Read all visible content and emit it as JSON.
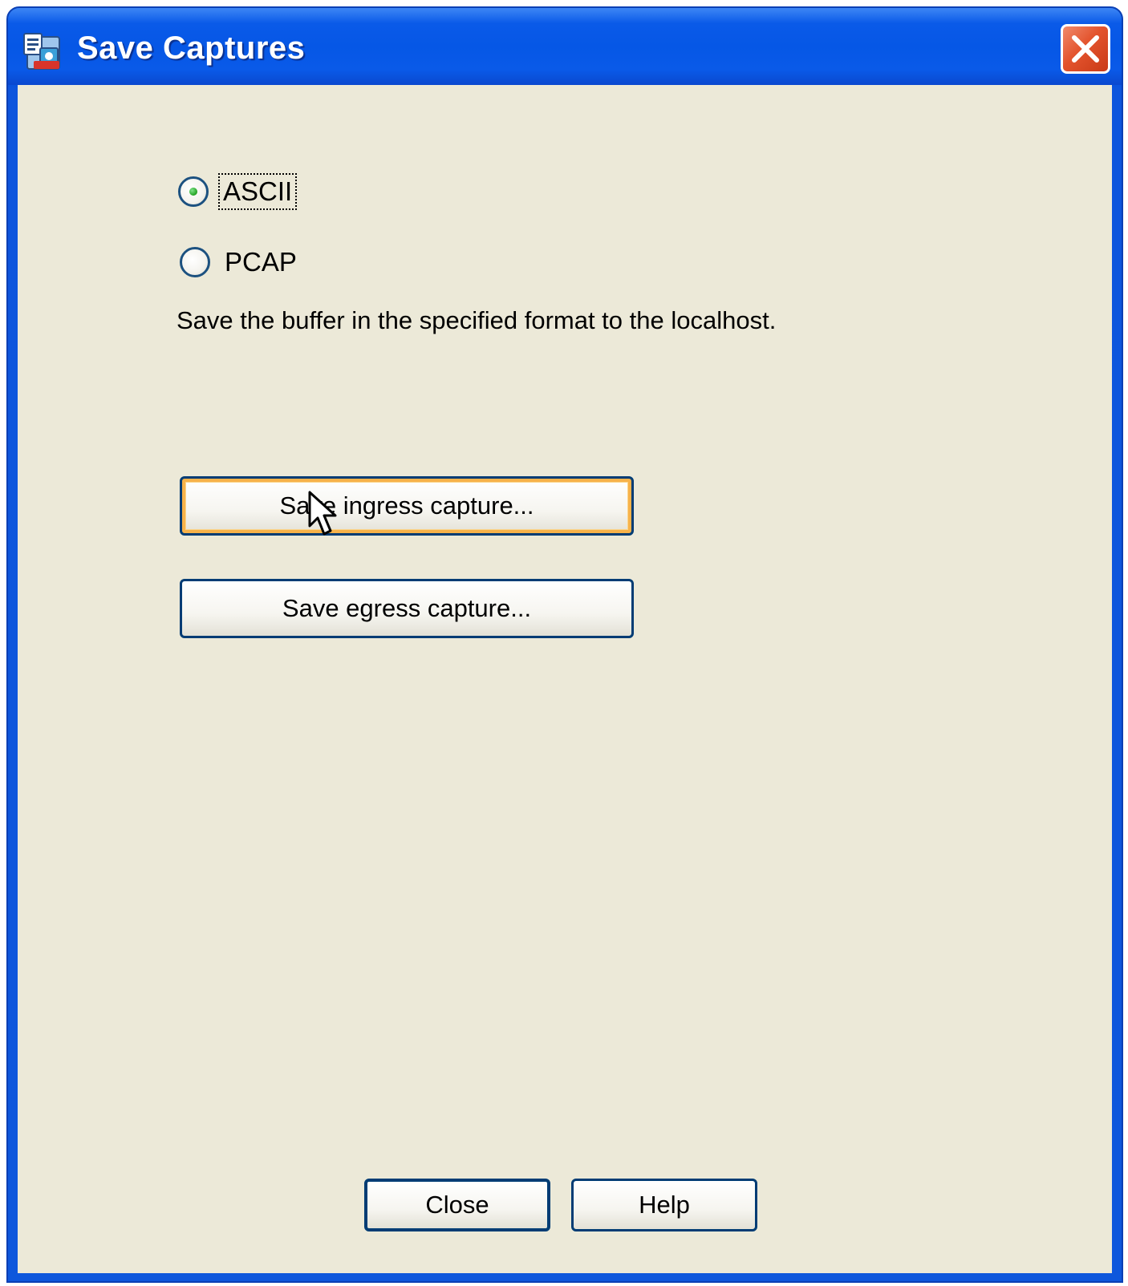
{
  "window": {
    "title": "Save Captures",
    "title_icon": "asdm-app-icon",
    "close_icon": "close-x-icon"
  },
  "format": {
    "options": [
      {
        "label": "ASCII",
        "selected": true
      },
      {
        "label": "PCAP",
        "selected": false
      }
    ],
    "description": "Save the buffer in the specified format to the localhost."
  },
  "actions": {
    "save_ingress_label": "Save ingress capture...",
    "save_egress_label": "Save egress capture..."
  },
  "footer": {
    "close_label": "Close",
    "help_label": "Help"
  },
  "colors": {
    "titlebar": "#0a5ae6",
    "client_background": "#ece9d8",
    "close_button": "#e3532d",
    "button_border": "#003c74",
    "hover_highlight": "#f7b24a"
  }
}
